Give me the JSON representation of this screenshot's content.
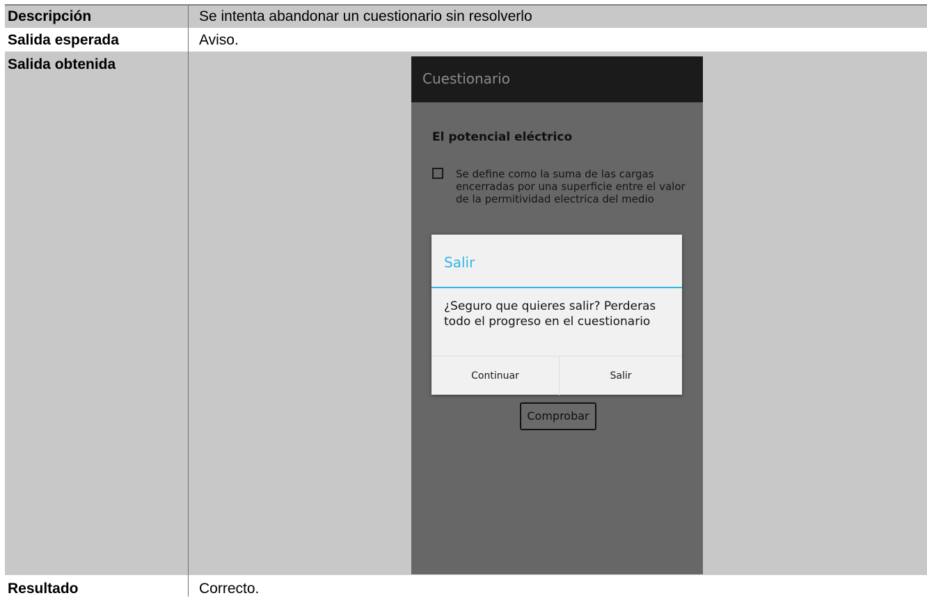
{
  "rows": {
    "descripcion": {
      "label": "Descripción",
      "value": "Se intenta abandonar un cuestionario sin resolverlo"
    },
    "salida_esperada": {
      "label": "Salida esperada",
      "value": "Aviso."
    },
    "salida_obtenida": {
      "label": "Salida obtenida"
    },
    "resultado": {
      "label": "Resultado",
      "value": "Correcto."
    }
  },
  "app": {
    "title": "Cuestionario",
    "question": "El potencial eléctrico",
    "option_1": "Se define como la suma de las cargas encerradas por una superficie entre el valor de la permitividad electrica del medio",
    "check_button": "Comprobar"
  },
  "dialog": {
    "title": "Salir",
    "message": "¿Seguro que quieres salir? Perderas todo el progreso en el cuestionario",
    "continue_button": "Continuar",
    "exit_button": "Salir",
    "accent_color": "#33b5e5"
  }
}
